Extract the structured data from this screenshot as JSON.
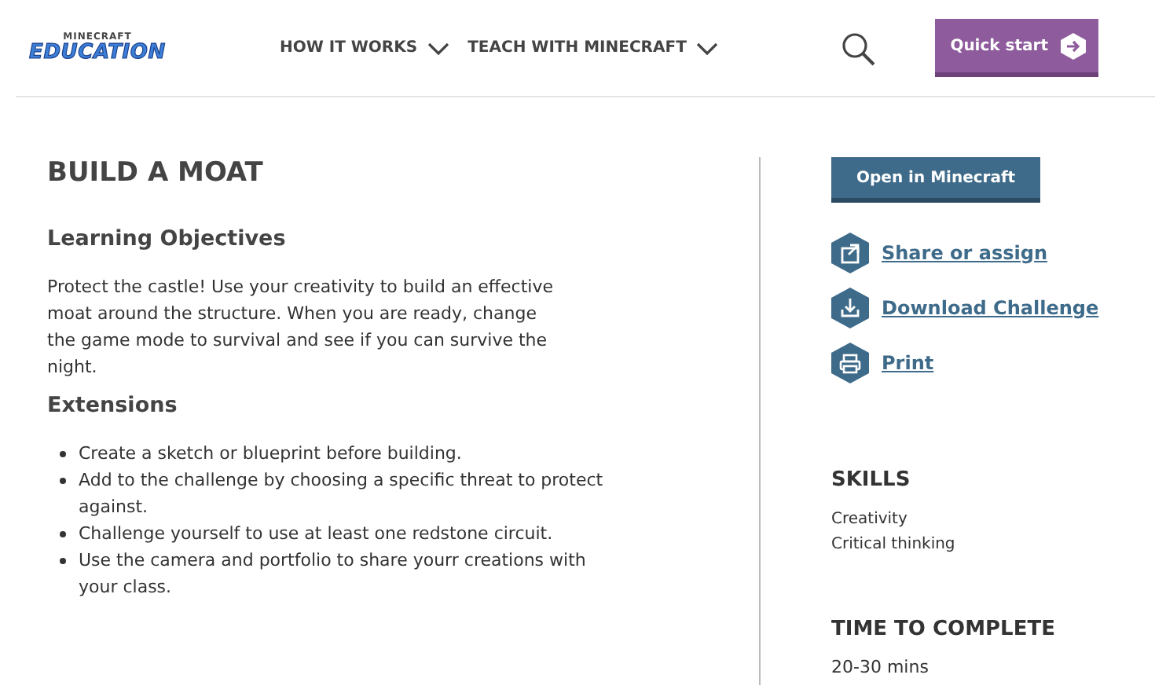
{
  "header": {
    "logo": {
      "top": "MINECRAFT",
      "bottom": "EDUCATION"
    },
    "nav": [
      {
        "label": "HOW IT WORKS"
      },
      {
        "label": "TEACH WITH MINECRAFT"
      }
    ],
    "quick_start": "Quick start"
  },
  "main": {
    "title": "BUILD A MOAT",
    "objectives_heading": "Learning Objectives",
    "objectives_text": "Protect the castle! Use your creativity to build an effective moat around the structure. When you are ready, change the game mode to survival and see if you can survive the night.",
    "extensions_heading": "Extensions",
    "extensions": [
      "Create a sketch or blueprint before building.",
      "Add to the challenge by choosing a specific threat to protect against.",
      "Challenge yourself to use at least one redstone circuit.",
      "Use the camera and portfolio to share yourr creations with your class."
    ]
  },
  "sidebar": {
    "open_button": "Open in Minecraft",
    "actions": [
      {
        "kind": "share",
        "label": "Share or assign"
      },
      {
        "kind": "download",
        "label": "Download Challenge"
      },
      {
        "kind": "print",
        "label": "Print"
      }
    ],
    "skills_heading": "SKILLS",
    "skills": [
      "Creativity",
      "Critical thinking"
    ],
    "time_heading": "TIME TO COMPLETE",
    "time": "20-30 mins"
  }
}
